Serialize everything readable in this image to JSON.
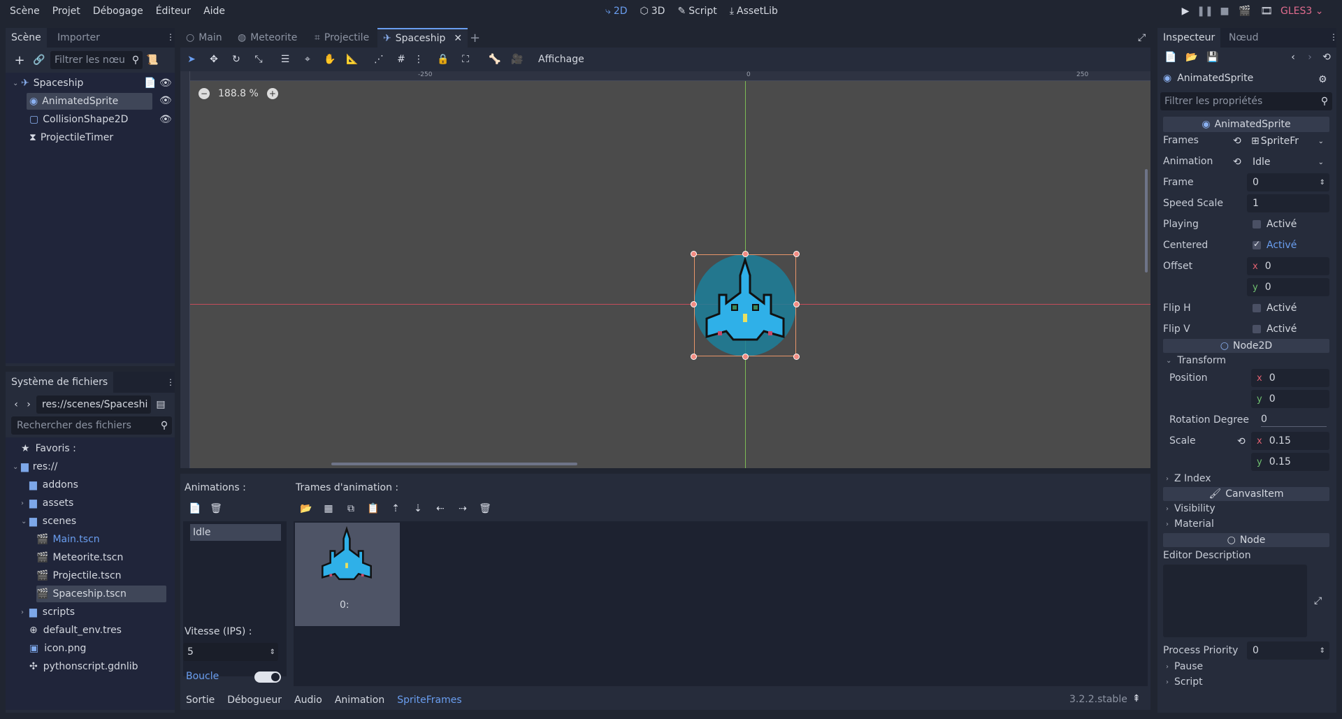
{
  "menu": {
    "items": [
      "Scène",
      "Projet",
      "Débogage",
      "Éditeur",
      "Aide"
    ],
    "modes": [
      "2D",
      "3D",
      "Script",
      "AssetLib"
    ],
    "renderer": "GLES3"
  },
  "scene_dock": {
    "tabs": [
      "Scène",
      "Importer"
    ],
    "filter_placeholder": "Filtrer les nœu",
    "tree": [
      {
        "label": "Spaceship",
        "icon": "spaceship-node-icon"
      },
      {
        "label": "AnimatedSprite",
        "icon": "animated-sprite-icon"
      },
      {
        "label": "CollisionShape2D",
        "icon": "collision-shape-icon"
      },
      {
        "label": "ProjectileTimer",
        "icon": "timer-icon"
      }
    ]
  },
  "filesystem": {
    "title": "Système de fichiers",
    "path": "res://scenes/Spaceshi",
    "search_placeholder": "Rechercher des fichiers",
    "items": [
      {
        "label": "Favoris :"
      },
      {
        "label": "res://"
      },
      {
        "label": "addons"
      },
      {
        "label": "assets"
      },
      {
        "label": "scenes"
      },
      {
        "label": "Main.tscn"
      },
      {
        "label": "Meteorite.tscn"
      },
      {
        "label": "Projectile.tscn"
      },
      {
        "label": "Spaceship.tscn"
      },
      {
        "label": "scripts"
      },
      {
        "label": "default_env.tres"
      },
      {
        "label": "icon.png"
      },
      {
        "label": "pythonscript.gdnlib"
      }
    ]
  },
  "editor_tabs": [
    "Main",
    "Meteorite",
    "Projectile",
    "Spaceship"
  ],
  "toolbar": {
    "view_label": "Affichage"
  },
  "viewport": {
    "zoom": "188.8 %",
    "ruler_labels": [
      "-250",
      "0",
      "250"
    ]
  },
  "bottom_panel": {
    "animations_label": "Animations :",
    "frames_label": "Trames d'animation :",
    "animation_list": [
      "Idle"
    ],
    "frame_label": "0:",
    "speed_label": "Vitesse (IPS) :",
    "speed_value": "5",
    "loop_label": "Boucle",
    "tabs": [
      "Sortie",
      "Débogueur",
      "Audio",
      "Animation",
      "SpriteFrames"
    ],
    "version": "3.2.2.stable"
  },
  "inspector": {
    "tabs": [
      "Inspecteur",
      "Nœud"
    ],
    "node_name": "AnimatedSprite",
    "filter_placeholder": "Filtrer les propriétés",
    "class_header": "AnimatedSprite",
    "props": {
      "frames_label": "Frames",
      "frames_value": "SpriteFr",
      "animation_label": "Animation",
      "animation_value": "Idle",
      "frame_label": "Frame",
      "frame_value": "0",
      "speed_label": "Speed Scale",
      "speed_value": "1",
      "playing_label": "Playing",
      "playing_value": "Activé",
      "centered_label": "Centered",
      "centered_value": "Activé",
      "offset_label": "Offset",
      "offset_x": "0",
      "offset_y": "0",
      "fliph_label": "Flip H",
      "fliph_value": "Activé",
      "flipv_label": "Flip V",
      "flipv_value": "Activé"
    },
    "node2d_header": "Node2D",
    "transform_label": "Transform",
    "position_label": "Position",
    "position_x": "0",
    "position_y": "0",
    "rotation_label": "Rotation Degree",
    "rotation_value": "0",
    "scale_label": "Scale",
    "scale_x": "0.15",
    "scale_y": "0.15",
    "zindex_label": "Z Index",
    "canvasitem_header": "CanvasItem",
    "visibility_label": "Visibility",
    "material_label": "Material",
    "node_header": "Node",
    "editor_desc_label": "Editor Description",
    "process_priority_label": "Process Priority",
    "process_priority_value": "0",
    "pause_label": "Pause",
    "script_label": "Script",
    "axis_x": "x",
    "axis_y": "y"
  }
}
